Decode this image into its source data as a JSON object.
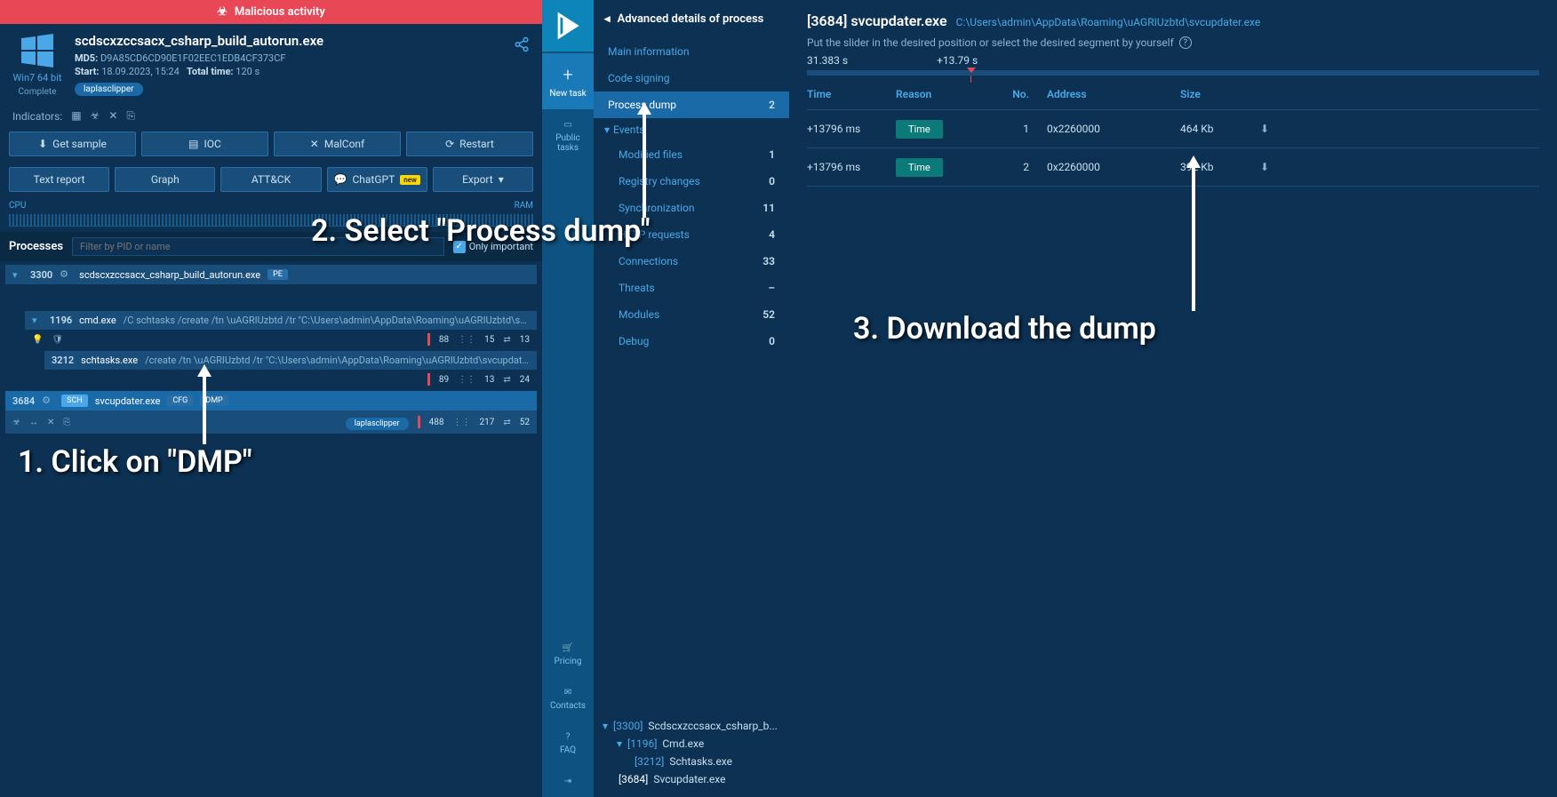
{
  "banner": {
    "text": "Malicious activity"
  },
  "task": {
    "name": "scdscxzccsacx_csharp_build_autorun.exe",
    "md5_label": "MD5:",
    "md5": "D9A85CD6CD90E1F02EEC1EDB4CF373CF",
    "start_label": "Start:",
    "start": "18.09.2023, 15:24",
    "total_label": "Total time:",
    "total": "120 s",
    "tag": "laplasclipper",
    "os_line1": "Win7 64 bit",
    "os_line2": "Complete"
  },
  "indicators": {
    "label": "Indicators:"
  },
  "buttons_row1": {
    "sample": "Get sample",
    "ioc": "IOC",
    "malconf": "MalConf",
    "restart": "Restart"
  },
  "buttons_row2": {
    "text_report": "Text report",
    "graph": "Graph",
    "attck": "ATT&CK",
    "chatgpt": "ChatGPT",
    "chatgpt_badge": "new",
    "export": "Export"
  },
  "perf": {
    "cpu": "CPU",
    "ram": "RAM"
  },
  "processes": {
    "title": "Processes",
    "filter_placeholder": "Filter by PID or name",
    "only_important": "Only important"
  },
  "proc_tree": [
    {
      "pid": "3300",
      "name": "scdscxzccsacx_csharp_build_autorun.exe",
      "tags": [
        "PE"
      ]
    },
    {
      "pid": "1196",
      "name": "cmd.exe",
      "args": "/C schtasks /create /tn \\uAGRIUzbtd /tr \"C:\\Users\\admin\\AppData\\Roaming\\uAGRIUzbtd\\svcupda...",
      "stats": {
        "a": "88",
        "b": "15",
        "c": "13"
      }
    },
    {
      "pid": "3212",
      "name": "schtasks.exe",
      "args": "/create /tn \\uAGRIUzbtd /tr \"C:\\Users\\admin\\AppData\\Roaming\\uAGRIUzbtd\\svcupdater....",
      "stats": {
        "a": "89",
        "b": "13",
        "c": "24"
      }
    },
    {
      "pid": "3684",
      "name": "svcupdater.exe",
      "badge": "SCH",
      "tags": [
        "CFG",
        "DMP"
      ],
      "stats": {
        "a": "488",
        "b": "217",
        "c": "52"
      },
      "tag": "laplasclipper"
    }
  ],
  "rail": {
    "new_task": "New task",
    "public_tasks": "Public tasks",
    "pricing": "Pricing",
    "contacts": "Contacts",
    "faq": "FAQ"
  },
  "details": {
    "title": "Advanced details of process",
    "items": [
      {
        "label": "Main information"
      },
      {
        "label": "Code signing"
      },
      {
        "label": "Process dump",
        "count": "2",
        "active": true
      },
      {
        "group": "Events"
      },
      {
        "label": "Modified files",
        "count": "1",
        "indent": true
      },
      {
        "label": "Registry changes",
        "count": "0",
        "indent": true
      },
      {
        "label": "Synchronization",
        "count": "11",
        "indent": true
      },
      {
        "label": "HTTP requests",
        "count": "4",
        "indent": true
      },
      {
        "label": "Connections",
        "count": "33",
        "indent": true
      },
      {
        "label": "Threats",
        "count": "–",
        "indent": true
      },
      {
        "label": "Modules",
        "count": "52",
        "indent": true
      },
      {
        "label": "Debug",
        "count": "0",
        "indent": true
      }
    ]
  },
  "mini_tree": [
    {
      "pid": "[3300]",
      "name": "Scdscxzccsacx_csharp_b...",
      "depth": 0,
      "open": true
    },
    {
      "pid": "[1196]",
      "name": "Cmd.exe",
      "depth": 1,
      "open": true
    },
    {
      "pid": "[3212]",
      "name": "Schtasks.exe",
      "depth": 2
    },
    {
      "pid": "[3684]",
      "name": "Svcupdater.exe",
      "depth": 0
    }
  ],
  "right": {
    "title_pid": "[3684]",
    "title_name": "svcupdater.exe",
    "path": "C:\\Users\\admin\\AppData\\Roaming\\uAGRIUzbtd\\svcupdater.exe",
    "hint": "Put the slider in the desired position or select the desired segment by yourself",
    "t_start": "31.383 s",
    "t_delta": "+13.79 s",
    "cols": {
      "time": "Time",
      "reason": "Reason",
      "no": "No.",
      "addr": "Address",
      "size": "Size"
    },
    "rows": [
      {
        "time": "+13796 ms",
        "reason": "Time",
        "no": "1",
        "addr": "0x2260000",
        "size": "464 Kb"
      },
      {
        "time": "+13796 ms",
        "reason": "Time",
        "no": "2",
        "addr": "0x2260000",
        "size": "392 Kb"
      }
    ]
  },
  "annotations": {
    "step1": "1. Click on \"DMP\"",
    "step2": "2. Select \"Process dump\"",
    "step3": "3. Download the dump"
  }
}
